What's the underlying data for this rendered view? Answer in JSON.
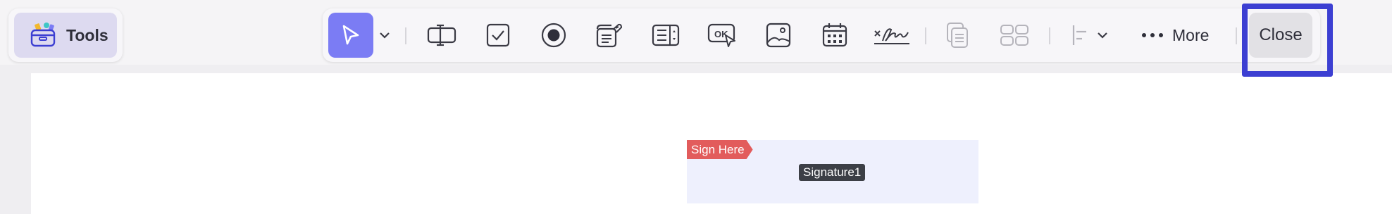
{
  "left_panel": {
    "tools_label": "Tools"
  },
  "toolbar": {
    "more_label": "More",
    "close_label": "Close",
    "buttons": [
      "select-pointer",
      "text-field",
      "checkbox",
      "radio-button",
      "combo-box",
      "list-box",
      "button",
      "image-field",
      "date-field",
      "digital-signature",
      "duplicate",
      "multiple-select",
      "align"
    ]
  },
  "document": {
    "signature_field": {
      "tag_label": "Sign Here",
      "field_name": "Signature1"
    }
  },
  "colors": {
    "accent": "#7b7cf4",
    "highlight": "#3c3fd2",
    "sign_tag": "#e25c5c",
    "field_bg": "#eef0fd"
  }
}
